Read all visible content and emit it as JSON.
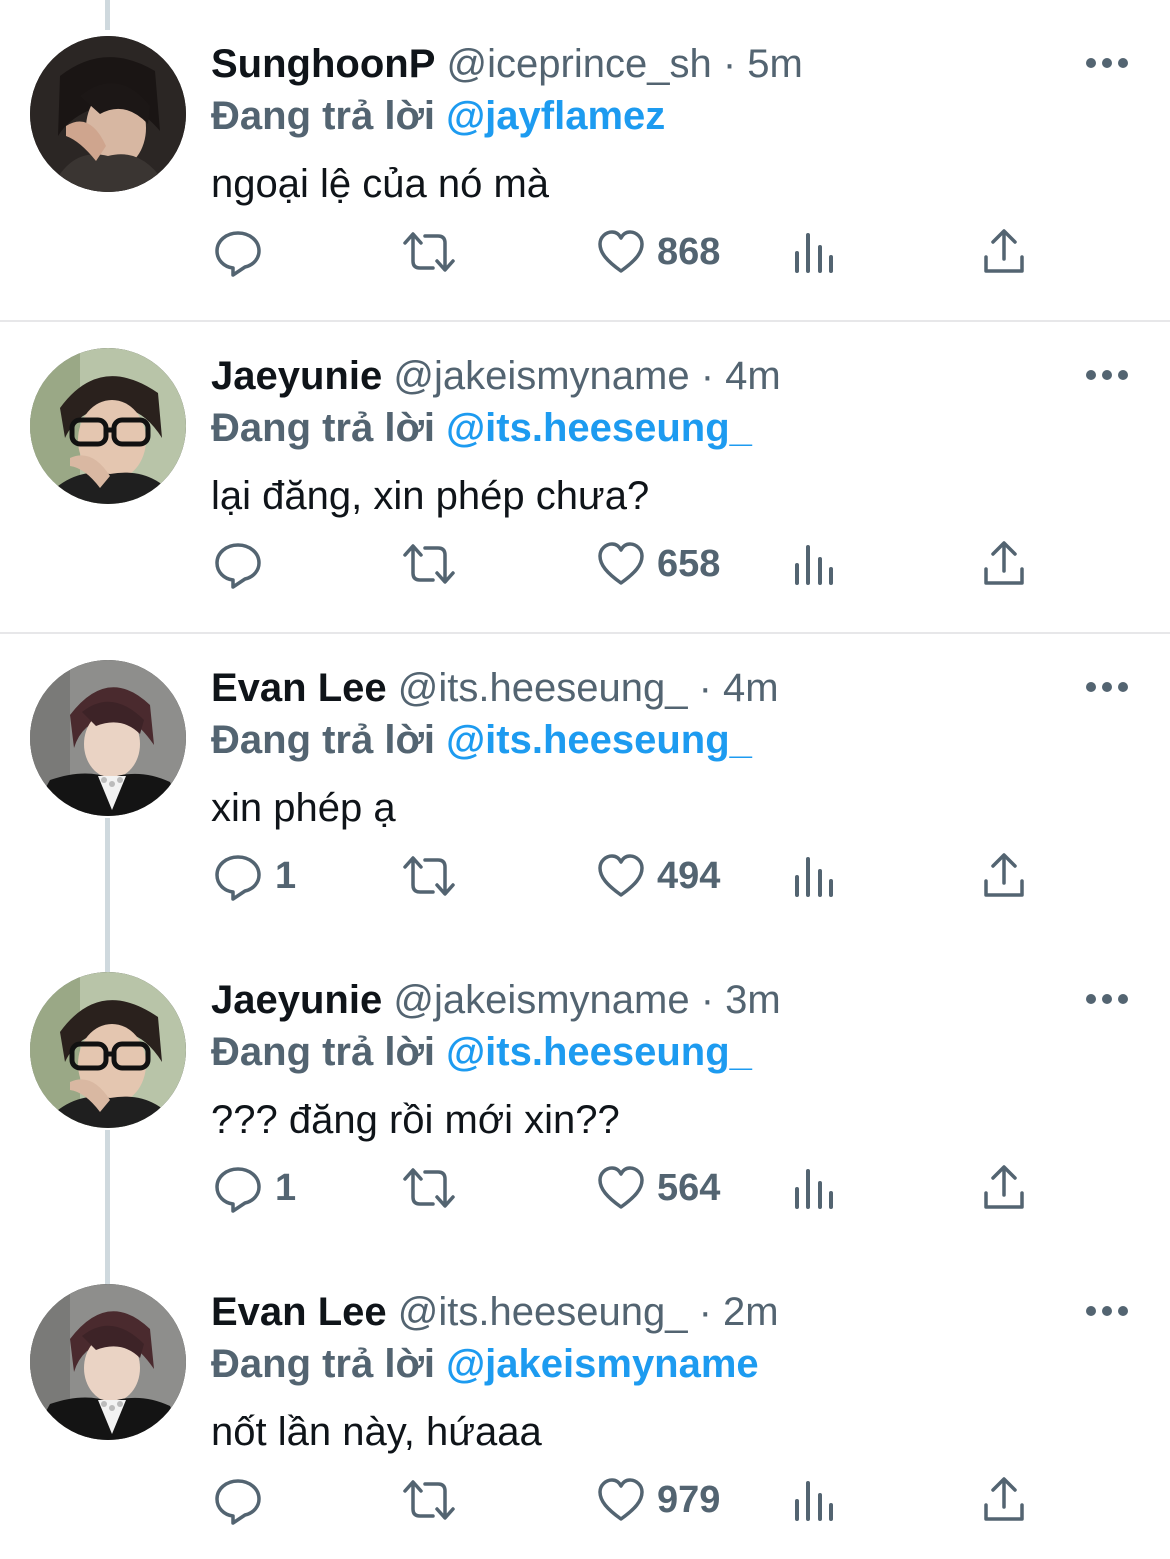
{
  "reply_prefix": "Đang trả lời",
  "separator": "·",
  "colors": {
    "accent": "#1d9bf0",
    "secondary_text": "#536471",
    "primary_text": "#0f1419"
  },
  "tweets": [
    {
      "name": "SunghoonP",
      "handle": "@iceprince_sh",
      "time": "5m",
      "reply_to": "@jayflamez",
      "text": "ngoại lệ của nó mà",
      "replies": "",
      "retweets": "",
      "likes": "868",
      "avatar_icon": "avatar-sunghoonp"
    },
    {
      "name": "Jaeyunie",
      "handle": "@jakeismyname",
      "time": "4m",
      "reply_to": "@its.heeseung_",
      "text": "lại đăng, xin phép chưa?",
      "replies": "",
      "retweets": "",
      "likes": "658",
      "avatar_icon": "avatar-jaeyunie"
    },
    {
      "name": "Evan Lee",
      "handle": "@its.heeseung_",
      "time": "4m",
      "reply_to": "@its.heeseung_",
      "text": "xin phép ạ",
      "replies": "1",
      "retweets": "",
      "likes": "494",
      "avatar_icon": "avatar-evan-lee"
    },
    {
      "name": "Jaeyunie",
      "handle": "@jakeismyname",
      "time": "3m",
      "reply_to": "@its.heeseung_",
      "text": "??? đăng rồi mới xin??",
      "replies": "1",
      "retweets": "",
      "likes": "564",
      "avatar_icon": "avatar-jaeyunie"
    },
    {
      "name": "Evan Lee",
      "handle": "@its.heeseung_",
      "time": "2m",
      "reply_to": "@jakeismyname",
      "text": "nốt lần này, hứaaa",
      "replies": "",
      "retweets": "",
      "likes": "979",
      "avatar_icon": "avatar-evan-lee"
    }
  ]
}
